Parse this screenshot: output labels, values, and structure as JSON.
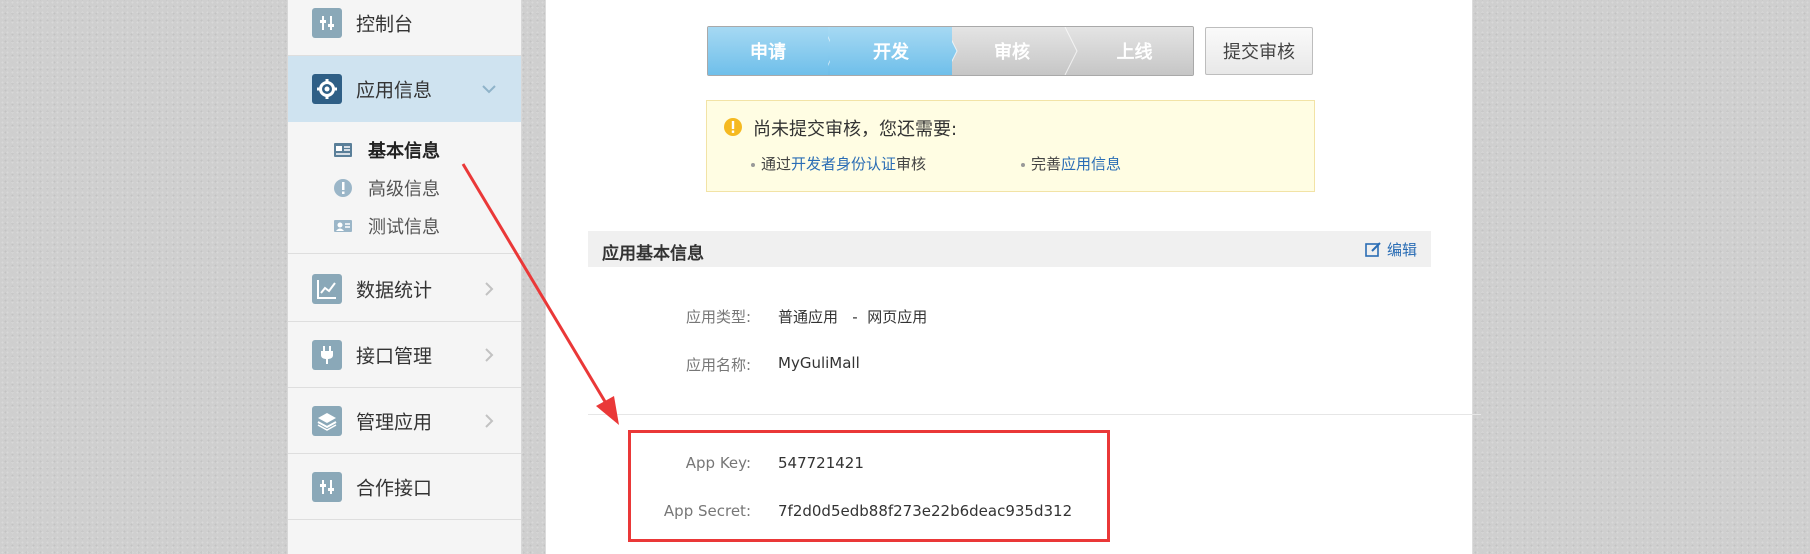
{
  "sidebar": {
    "items": [
      {
        "label": "控制台",
        "icon": "sliders-icon"
      },
      {
        "label": "应用信息",
        "icon": "gear-icon"
      },
      {
        "label": "数据统计",
        "icon": "chart-icon"
      },
      {
        "label": "接口管理",
        "icon": "plug-icon"
      },
      {
        "label": "管理应用",
        "icon": "layers-icon"
      },
      {
        "label": "合作接口",
        "icon": "sliders-icon"
      }
    ],
    "sub_items": [
      {
        "label": "基本信息",
        "icon": "id-card-icon"
      },
      {
        "label": "高级信息",
        "icon": "info-icon"
      },
      {
        "label": "测试信息",
        "icon": "person-card-icon"
      }
    ]
  },
  "steps": [
    "申请",
    "开发",
    "审核",
    "上线"
  ],
  "submit_button": "提交审核",
  "notice": {
    "text": "尚未提交审核，您还需要:",
    "item1_prefix": "通过",
    "item1_link": "开发者身份认证",
    "item1_suffix": "审核",
    "item2_prefix": "完善",
    "item2_link": "应用信息"
  },
  "section": {
    "title": "应用基本信息",
    "edit": "编辑"
  },
  "fields": {
    "app_type_label": "应用类型:",
    "app_type_value": "普通应用   -  网页应用",
    "app_name_label": "应用名称:",
    "app_name_value": "MyGuliMall",
    "app_key_label": "App Key:",
    "app_key_value": "547721421",
    "app_secret_label": "App Secret:",
    "app_secret_value": "7f2d0d5edb88f273e22b6deac935d312"
  },
  "colors": {
    "step_done": "#6fbfea",
    "link": "#2a6db5",
    "annotation_red": "#ea3838",
    "sidebar_active": "#cfe3f0"
  }
}
